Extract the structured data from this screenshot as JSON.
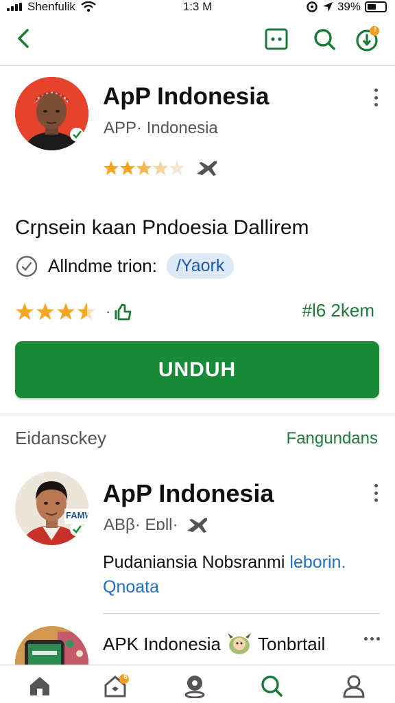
{
  "status_bar": {
    "carrier": "Shenfulik",
    "time": "1:3 M",
    "battery": "39%"
  },
  "top_bar": {
    "back_icon": "chevron-left-icon",
    "actions": [
      "chat-icon",
      "search-icon",
      "notification-icon"
    ],
    "notification_badge": "!"
  },
  "featured_app": {
    "title": "ApP Indonesia",
    "subtitle": "APP· Indonesia",
    "rating_icon": "verified-icon",
    "headline": "Crɲsein kaan Pndoesia Dallirem",
    "info_label": "Allndme trion:",
    "info_pill": "/Yaork",
    "rating_tail": "·",
    "size": "#l6 2kem",
    "install_label": "UNDUH",
    "accent": "#1a8a38"
  },
  "section": {
    "title": "Eidansckey",
    "link": "Fangundans"
  },
  "list_items": [
    {
      "title": "ApP Indonesia",
      "subtitle": "ABβ· Eɒll·",
      "avatar_tag": "FAMW",
      "description": "Pudaniansia Νobsranmi",
      "description_link": "leborin.",
      "description_link2": "Qnoata"
    },
    {
      "title_a": "APK Indonesia",
      "title_b": "Tonbrtail"
    }
  ],
  "bottom_nav": {
    "items": [
      "home-icon",
      "categories-icon",
      "location-icon",
      "search-icon",
      "profile-icon"
    ],
    "badge": "6",
    "active_index": 3
  }
}
